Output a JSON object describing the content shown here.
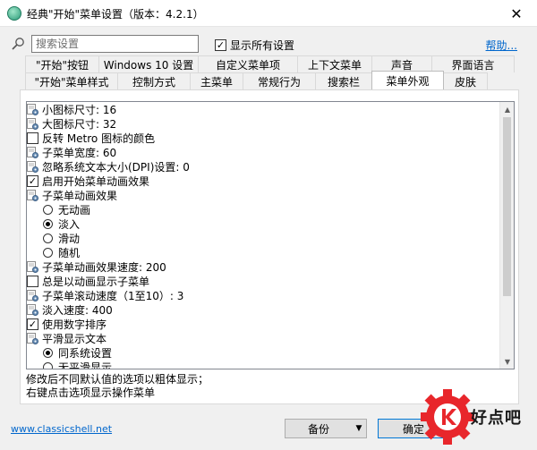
{
  "window": {
    "title": "经典\"开始\"菜单设置（版本：4.2.1）",
    "close_glyph": "✕"
  },
  "search": {
    "placeholder": "搜索设置",
    "show_all_label": "显示所有设置",
    "show_all_checked": true,
    "help_label": "帮助..."
  },
  "tabs": {
    "row1": [
      {
        "label": "\"开始\"按钮",
        "w": 83
      },
      {
        "label": "Windows 10 设置",
        "w": 112
      },
      {
        "label": "自定义菜单项",
        "w": 112
      },
      {
        "label": "上下文菜单",
        "w": 84
      },
      {
        "label": "声音",
        "w": 68
      },
      {
        "label": "界面语言",
        "w": 93
      }
    ],
    "row2": [
      {
        "label": "\"开始\"菜单样式",
        "w": 104
      },
      {
        "label": "控制方式",
        "w": 82
      },
      {
        "label": "主菜单",
        "w": 60
      },
      {
        "label": "常规行为",
        "w": 82
      },
      {
        "label": "搜索栏",
        "w": 64
      },
      {
        "label": "菜单外观",
        "w": 81,
        "active": true
      },
      {
        "label": "皮肤",
        "w": 50
      }
    ]
  },
  "settings": [
    {
      "type": "icon",
      "label": "小图标尺寸: 16"
    },
    {
      "type": "icon",
      "label": "大图标尺寸: 32"
    },
    {
      "type": "checkbox",
      "checked": false,
      "label": "反转 Metro 图标的颜色"
    },
    {
      "type": "icon",
      "label": "子菜单宽度: 60"
    },
    {
      "type": "icon",
      "label": "忽略系统文本大小(DPI)设置: 0"
    },
    {
      "type": "checkbox",
      "checked": true,
      "label": "启用开始菜单动画效果"
    },
    {
      "type": "icon",
      "label": "子菜单动画效果"
    },
    {
      "type": "radio",
      "checked": false,
      "label": "无动画"
    },
    {
      "type": "radio",
      "checked": true,
      "label": "淡入"
    },
    {
      "type": "radio",
      "checked": false,
      "label": "滑动"
    },
    {
      "type": "radio",
      "checked": false,
      "label": "随机"
    },
    {
      "type": "icon",
      "label": "子菜单动画效果速度: 200"
    },
    {
      "type": "checkbox",
      "checked": false,
      "label": "总是以动画显示子菜单"
    },
    {
      "type": "icon",
      "label": "子菜单滚动速度（1至10）: 3"
    },
    {
      "type": "icon",
      "label": "淡入速度: 400"
    },
    {
      "type": "checkbox",
      "checked": true,
      "label": "使用数字排序"
    },
    {
      "type": "icon",
      "label": "平滑显示文本"
    },
    {
      "type": "radio",
      "checked": true,
      "label": "同系统设置"
    },
    {
      "type": "radio",
      "checked": false,
      "label": "无平滑显示"
    }
  ],
  "hint": {
    "line1": "修改后不同默认值的选项以粗体显示；",
    "line2": "右键点击选项显示操作菜单"
  },
  "footer": {
    "site_link": "www.classicshell.net",
    "backup_label": "备份",
    "ok_label": "确定"
  },
  "watermark": {
    "text": "好点吧"
  },
  "colors": {
    "accent": "#0078d7",
    "link": "#0066cc",
    "watermark_red": "#e8262b"
  }
}
